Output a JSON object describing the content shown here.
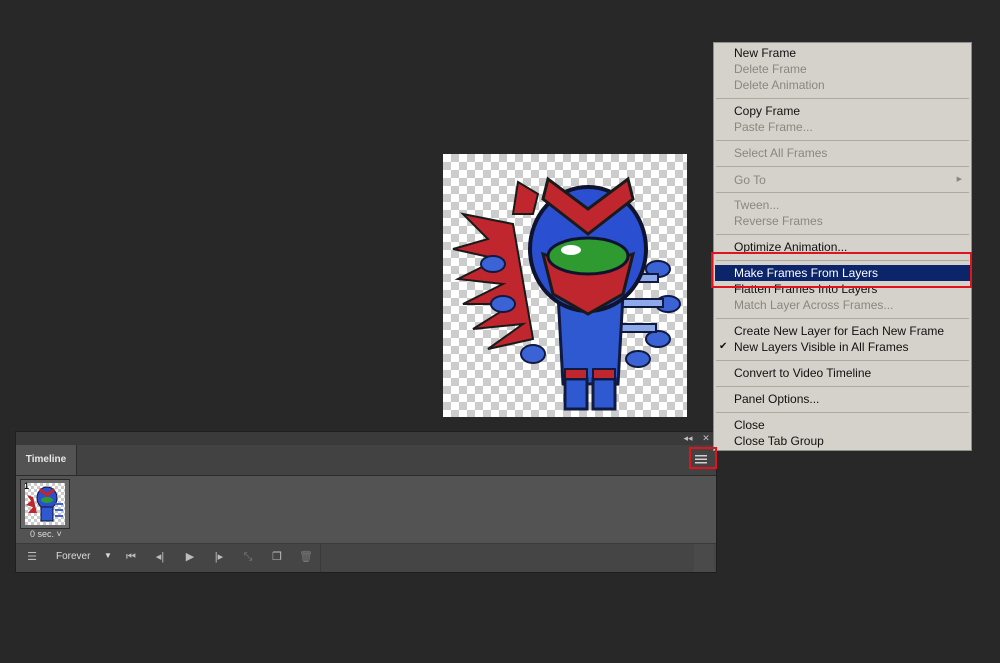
{
  "timeline": {
    "tab_label": "Timeline",
    "collapse_icon": "double-chevron-left-icon",
    "close_icon": "close-icon",
    "panel_menu_icon": "hamburger-menu-icon",
    "frame": {
      "number": "1",
      "delay": "0 sec."
    },
    "loop_option": "Forever",
    "controls": [
      "convert-timeline-icon",
      "first-frame-icon",
      "previous-frame-icon",
      "play-icon",
      "next-frame-icon",
      "tween-icon",
      "duplicate-frame-icon",
      "delete-frame-icon"
    ]
  },
  "menu": {
    "items": [
      {
        "label": "New Frame",
        "enabled": true
      },
      {
        "label": "Delete Frame",
        "enabled": false
      },
      {
        "label": "Delete Animation",
        "enabled": false
      },
      {
        "label": "Copy Frame",
        "enabled": true
      },
      {
        "label": "Paste Frame...",
        "enabled": false
      },
      {
        "label": "Select All Frames",
        "enabled": false
      },
      {
        "label": "Go To",
        "enabled": false,
        "submenu": true
      },
      {
        "label": "Tween...",
        "enabled": false
      },
      {
        "label": "Reverse Frames",
        "enabled": false
      },
      {
        "label": "Optimize Animation...",
        "enabled": true
      },
      {
        "label": "Make Frames From Layers",
        "enabled": true,
        "selected": true
      },
      {
        "label": "Flatten Frames Into Layers",
        "enabled": true
      },
      {
        "label": "Match Layer Across Frames...",
        "enabled": false
      },
      {
        "label": "Create New Layer for Each New Frame",
        "enabled": true
      },
      {
        "label": "New Layers Visible in All Frames",
        "enabled": true,
        "checked": true
      },
      {
        "label": "Convert to Video Timeline",
        "enabled": true
      },
      {
        "label": "Panel Options...",
        "enabled": true
      },
      {
        "label": "Close",
        "enabled": true
      },
      {
        "label": "Close Tab Group",
        "enabled": true
      }
    ]
  },
  "colors": {
    "highlight_border": "#e0141e",
    "menu_selected_bg": "#0b246a",
    "menu_bg": "#d5d2cb",
    "app_bg": "#282828"
  }
}
